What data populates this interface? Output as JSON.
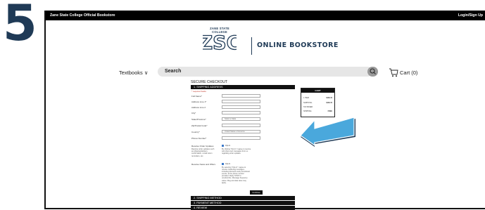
{
  "step_number": "5",
  "topbar": {
    "site_title": "Zane State College Official Bookstore",
    "login": "Login/Sign Up"
  },
  "header": {
    "logo_small": "ZANE STATE COLLEGE",
    "logo_letters": "ZSC",
    "brand": "ONLINE BOOKSTORE"
  },
  "nav": {
    "textbooks": "Textbooks ∨",
    "search_label": "Search",
    "cart_label": "Cart (0)"
  },
  "checkout": {
    "title": "SECURE CHECKOUT",
    "section1": "1.  SHIPPING ADDRESS",
    "required_note": "* required fields",
    "fields": [
      {
        "label": "Full Name*",
        "value": ""
      },
      {
        "label": "Address Line 1*",
        "value": ""
      },
      {
        "label": "Address Line 2",
        "value": ""
      },
      {
        "label": "City*",
        "value": ""
      },
      {
        "label": "State/Province*",
        "value": "Select a State"
      },
      {
        "label": "Zip/Postal Code*",
        "value": ""
      },
      {
        "label": "Country*",
        "value": "United States of America"
      },
      {
        "label": "Phone Number*",
        "value": ""
      }
    ],
    "order_updates": {
      "label": "Receive Order Updates",
      "desc": "Receive order updates such as shipping/delivery confirmation, rental return reminders, etc.",
      "opt": "Opt-In",
      "opt_desc": "By clicking \"Opt-In\" I agree to receive cell phone text messages from us regarding order updates."
    },
    "news_offers": {
      "label": "Receive News and Offers",
      "opt": "Opt-In",
      "opt_desc": "By selecting \"Opt-In\" I agree to receive marketing messages, including discounts and promotional events, at the phone number provided. Reply STOP to unsubscribe. Message frequency varies. Msg and data rates may apply."
    },
    "continue": "Continue",
    "section2": "2.  SHIPPING METHOD",
    "section3": "3.  PAYMENT METHOD",
    "section4": "4.  REVIEW"
  },
  "summary": {
    "header": "CART",
    "rows": [
      {
        "label": "1 ITEM",
        "value": "$183.15"
      },
      {
        "label": "SUBTOTAL",
        "value": "$183.15"
      },
      {
        "label": "TAX BASED",
        "value": ""
      },
      {
        "label": "SHIPPING",
        "value": "FREE"
      }
    ]
  },
  "colors": {
    "brand_navy": "#1f3a56",
    "arrow_blue": "#4aa8dc",
    "checkbox_blue": "#3a78c9"
  },
  "icons": {
    "search": "search-icon",
    "cart": "cart-icon",
    "arrow": "arrow-icon"
  }
}
